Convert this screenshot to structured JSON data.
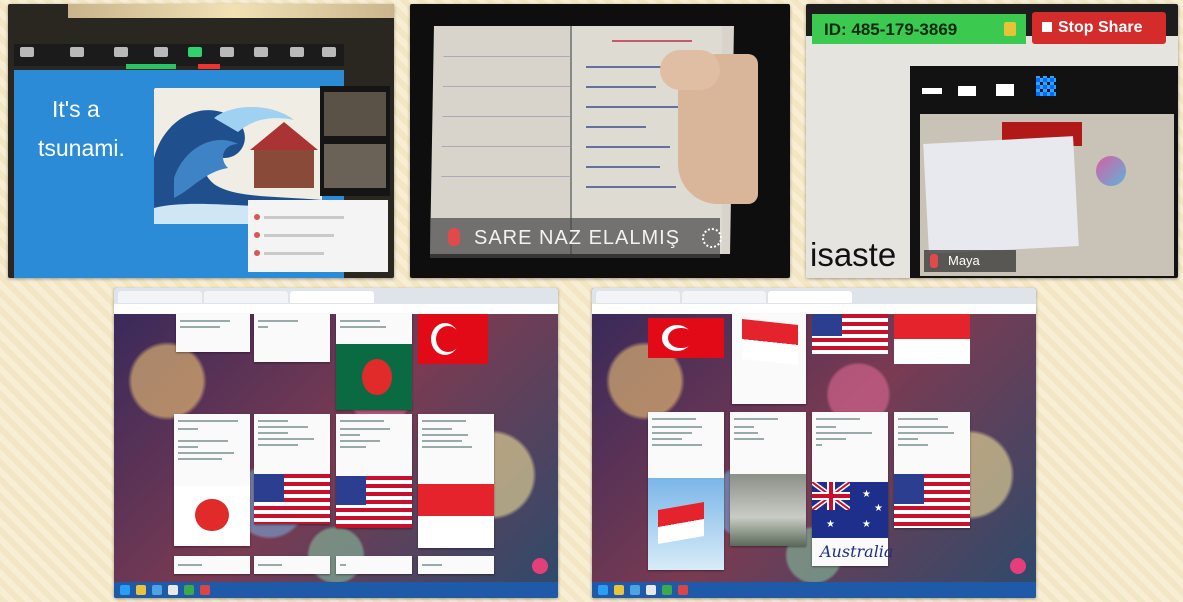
{
  "panel1": {
    "slide_line1": "It's a",
    "slide_line2": "tsunami."
  },
  "panel2": {
    "participant_name": "SARE NAZ ELALMIŞ"
  },
  "panel3": {
    "meeting_id": "ID: 485-179-3869",
    "stop_share_label": "Stop Share",
    "background_word": "isaste",
    "participant_name": "Maya"
  },
  "padlet_left": {
    "flags": [
      "japan-flag",
      "usa-flag",
      "usa-flag",
      "indonesia-flag",
      "bangladesh-flag",
      "turkey-flag"
    ]
  },
  "padlet_right": {
    "australia_label": "Australia",
    "flags": [
      "turkey-flag",
      "indonesia-flag",
      "usa-flag",
      "indonesia-flag",
      "indonesia-flag",
      "australia-flag",
      "usa-flag"
    ]
  },
  "colors": {
    "zoom_green": "#3cc94f",
    "stop_red": "#d42b2b",
    "slide_blue": "#2c8bd6",
    "padlet_fab": "#e43f7a"
  }
}
